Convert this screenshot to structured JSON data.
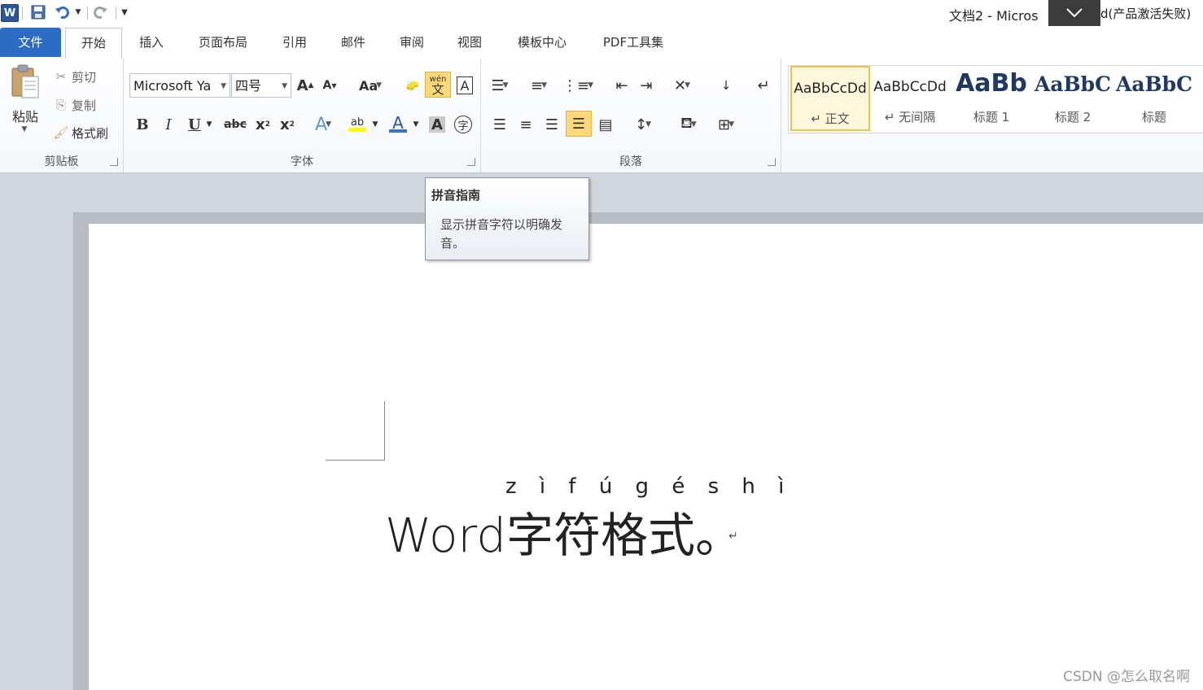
{
  "titlebar": {
    "logo": "W",
    "title": "文档2  -  Micros",
    "title_suffix": "d(产品激活失败)",
    "icons": [
      "word-logo-icon",
      "save-icon",
      "undo-icon",
      "redo-icon",
      "customize-icon"
    ]
  },
  "tabs": {
    "file": "文件",
    "items": [
      "开始",
      "插入",
      "页面布局",
      "引用",
      "邮件",
      "审阅",
      "视图",
      "模板中心",
      "PDF工具集"
    ]
  },
  "clipboard": {
    "paste": "粘贴",
    "cut": "剪切",
    "copy": "复制",
    "format_painter": "格式刷",
    "label": "剪贴板"
  },
  "font": {
    "name": "Microsoft Ya",
    "size": "四号",
    "grow": "A",
    "shrink": "A",
    "change_case": "Aa",
    "pinyin": "wén",
    "pinyin_char": "文",
    "border_char": "A",
    "bold": "B",
    "italic": "I",
    "underline": "U",
    "strike": "abc",
    "subscript": "x",
    "superscript": "x",
    "effects": "A",
    "highlight": "ab",
    "font_color": "A",
    "shading_char": "A",
    "enclose_char": "字",
    "label": "字体"
  },
  "paragraph": {
    "label": "段落"
  },
  "styles": {
    "items": [
      {
        "preview": "AaBbCcDd",
        "name": "↵ 正文"
      },
      {
        "preview": "AaBbCcDd",
        "name": "↵ 无间隔"
      },
      {
        "preview": "AaBb",
        "name": "标题 1"
      },
      {
        "preview": "AaBbC",
        "name": "标题 2"
      },
      {
        "preview": "AaBbC",
        "name": "标题"
      }
    ]
  },
  "tooltip": {
    "title": "拼音指南",
    "body": "显示拼音字符以明确发音。"
  },
  "document": {
    "ruby": "z ì f ú g é s h ì",
    "text": "Word字符格式。",
    "para_mark": "↵"
  },
  "watermark": "CSDN @怎么取名啊",
  "colors": {
    "file_tab": "#2b6cc4",
    "pressed": "#fbd878",
    "style_selected": "#f2c14a"
  }
}
